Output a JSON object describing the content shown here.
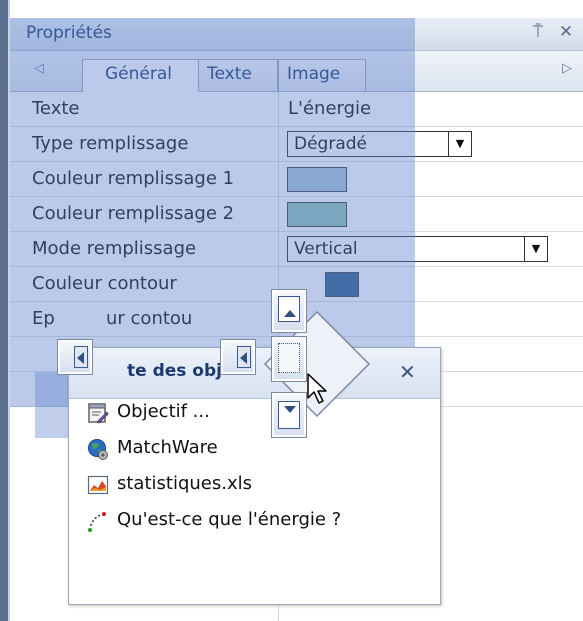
{
  "pane": {
    "title": "Propriétés",
    "pin_icon": "pin-icon",
    "close_icon": "close-icon"
  },
  "tabs": [
    {
      "label": "Général",
      "active": true
    },
    {
      "label": "Texte",
      "active": false
    },
    {
      "label": "Image",
      "active": false
    }
  ],
  "properties": [
    {
      "label": "Texte",
      "value": "L'énergie",
      "kind": "text"
    },
    {
      "label": "Type remplissage",
      "value": "Dégradé",
      "kind": "select"
    },
    {
      "label": "Couleur remplissage 1",
      "value": "#a7c4d4",
      "kind": "color"
    },
    {
      "label": "Couleur remplissage 2",
      "value": "#8fc2b6",
      "kind": "color"
    },
    {
      "label": "Mode remplissage",
      "value": "Vertical",
      "kind": "select"
    },
    {
      "label": "Couleur contour",
      "value": "#2f5f8a",
      "kind": "color"
    },
    {
      "label": "Epaisseur contour",
      "value": "",
      "kind": "text"
    }
  ],
  "visible_labels": {
    "epaisseur_left": "Ep",
    "epaisseur_right": "ur contou"
  },
  "float_window": {
    "title": "te des obj",
    "close_icon": "close-icon",
    "items": [
      {
        "label": "Objectif ...",
        "icon": "objective-icon"
      },
      {
        "label": "MatchWare",
        "icon": "globe-icon"
      },
      {
        "label": "statistiques.xls",
        "icon": "spreadsheet-icon"
      },
      {
        "label": "Qu'est-ce que l'énergie ?",
        "icon": "path-icon"
      }
    ]
  },
  "colors": {
    "dock_hint": "#5c80cd",
    "title_text": "#1b3a72"
  }
}
